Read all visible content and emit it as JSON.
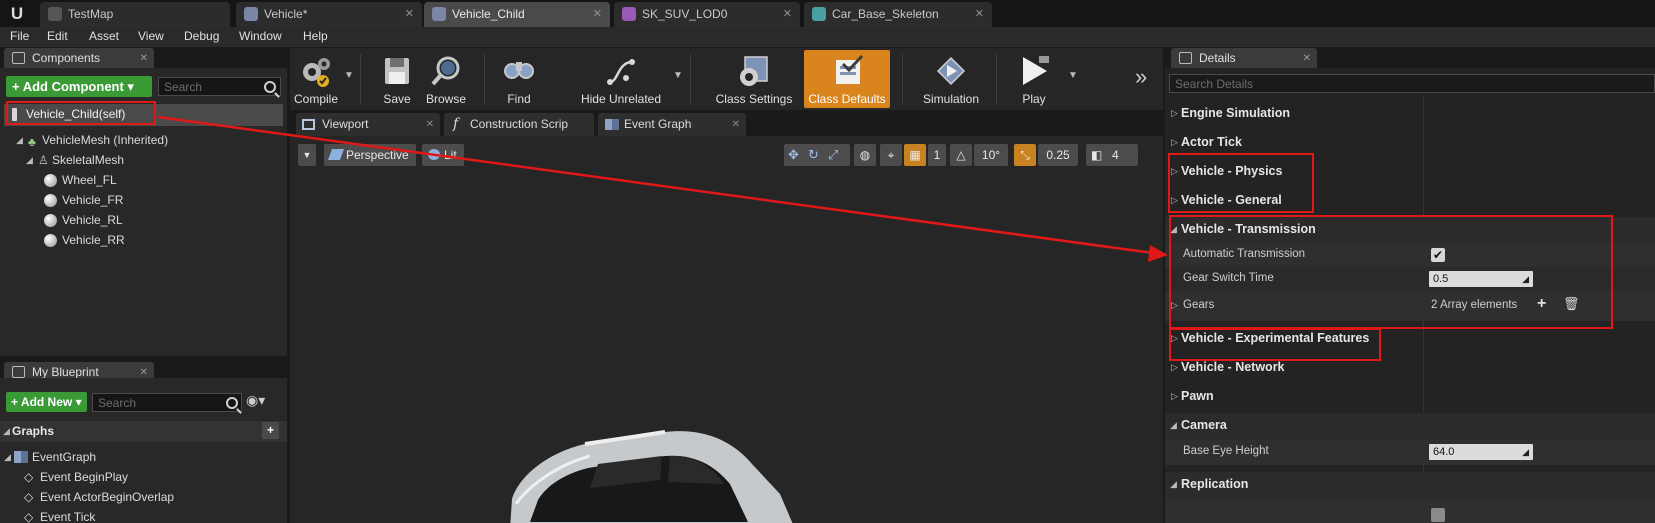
{
  "tabs": [
    {
      "label": "TestMap"
    },
    {
      "label": "Vehicle*"
    },
    {
      "label": "Vehicle_Child"
    },
    {
      "label": "SK_SUV_LOD0"
    },
    {
      "label": "Car_Base_Skeleton"
    }
  ],
  "menu": [
    "File",
    "Edit",
    "Asset",
    "View",
    "Debug",
    "Window",
    "Help"
  ],
  "components": {
    "tab_label": "Components",
    "add_button": "+ Add Component ▾",
    "search_placeholder": "Search",
    "self_item": "Vehicle_Child(self)",
    "tree": [
      {
        "label": "VehicleMesh (Inherited)"
      },
      {
        "label": "SkeletalMesh"
      },
      {
        "label": "Wheel_FL"
      },
      {
        "label": "Vehicle_FR"
      },
      {
        "label": "Vehicle_RL"
      },
      {
        "label": "Vehicle_RR"
      }
    ]
  },
  "my_blueprint": {
    "tab_label": "My Blueprint",
    "add_button": "+ Add New ▾",
    "search_placeholder": "Search",
    "graphs_header": "Graphs",
    "items": [
      {
        "label": "EventGraph"
      },
      {
        "label": "Event BeginPlay"
      },
      {
        "label": "Event ActorBeginOverlap"
      },
      {
        "label": "Event Tick"
      }
    ]
  },
  "toolbar": [
    {
      "label": "Compile",
      "icon": "compile-icon"
    },
    {
      "label": "Save",
      "icon": "save-icon"
    },
    {
      "label": "Browse",
      "icon": "browse-icon"
    },
    {
      "label": "Find",
      "icon": "find-icon"
    },
    {
      "label": "Hide Unrelated",
      "icon": "hide-unrelated-icon"
    },
    {
      "label": "Class Settings",
      "icon": "class-settings-icon"
    },
    {
      "label": "Class Defaults",
      "icon": "class-defaults-icon"
    },
    {
      "label": "Simulation",
      "icon": "simulation-icon"
    },
    {
      "label": "Play",
      "icon": "play-icon"
    }
  ],
  "editor_tabs": [
    {
      "label": "Viewport"
    },
    {
      "label": "Construction Scrip"
    },
    {
      "label": "Event Graph"
    }
  ],
  "viewport": {
    "perspective": "Perspective",
    "lit": "Lit",
    "snap_angle": "10°",
    "scale_snap": "0.25",
    "camera_speed": "4",
    "grid_value": "1"
  },
  "details": {
    "tab_label": "Details",
    "search_placeholder": "Search Details",
    "categories": [
      {
        "name": "Engine Simulation",
        "expanded": false
      },
      {
        "name": "Actor Tick",
        "expanded": false
      },
      {
        "name": "Vehicle - Physics",
        "expanded": false
      },
      {
        "name": "Vehicle - General",
        "expanded": false
      },
      {
        "name": "Vehicle - Transmission",
        "expanded": true
      },
      {
        "name": "Vehicle - Experimental Features",
        "expanded": false
      },
      {
        "name": "Vehicle - Network",
        "expanded": false
      },
      {
        "name": "Pawn",
        "expanded": false
      },
      {
        "name": "Camera",
        "expanded": true
      },
      {
        "name": "Replication",
        "expanded": true
      }
    ],
    "transmission": {
      "automatic_label": "Automatic Transmission",
      "automatic_checked": true,
      "gear_switch_label": "Gear Switch Time",
      "gear_switch_value": "0.5",
      "gears_label": "Gears",
      "gears_value": "2 Array elements"
    },
    "camera": {
      "base_eye_height_label": "Base Eye Height",
      "base_eye_height_value": "64.0"
    }
  },
  "colors": {
    "accent_orange": "#d9841d",
    "add_green": "#3a9a35",
    "annotation_red": "#e01818"
  }
}
